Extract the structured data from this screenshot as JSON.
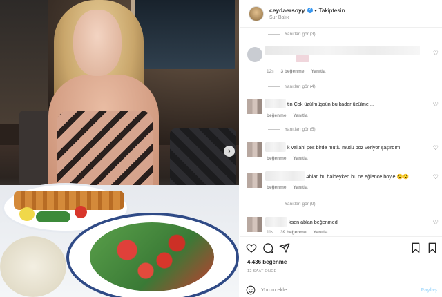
{
  "post": {
    "username": "ceydaersoyy",
    "follow_state": "Takiptesin",
    "location": "Sur Balık",
    "likes": "4.436 beğenme",
    "time": "12 SAAT ÖNCE"
  },
  "comments": [
    {
      "type": "view_replies",
      "text": "Yanıtları gör (3)"
    },
    {
      "type": "comment",
      "text": "",
      "meta_time": "12s",
      "meta_likes": "3 beğenme",
      "meta_reply": "Yanıtla"
    },
    {
      "type": "view_replies",
      "text": "Yanıtları gör (4)"
    },
    {
      "type": "comment",
      "text": "tin Çok üzülmüşsün bu kadar üzülme ...",
      "meta_likes": "beğenme",
      "meta_reply": "Yanıtla"
    },
    {
      "type": "view_replies",
      "text": "Yanıtları gör (5)"
    },
    {
      "type": "comment",
      "text": "k vallahi pes birde mutlu mutlu poz veriyor şaşırdım",
      "meta_likes": "beğenme",
      "meta_reply": "Yanıtla"
    },
    {
      "type": "comment",
      "text": "Ablan bu haldeyken bu ne eğlence böyle 😮😮",
      "meta_likes": "beğenme",
      "meta_reply": "Yanıtla"
    },
    {
      "type": "view_replies",
      "text": "Yanıtları gör (9)"
    },
    {
      "type": "comment",
      "text": "ksen ablan beğenmedi",
      "meta_time": "11s",
      "meta_likes": "39 beğenme",
      "meta_reply": "Yanıtla"
    }
  ],
  "add_comment": {
    "placeholder": "Yorum ekle...",
    "post_label": "Paylaş"
  },
  "icons": {
    "like": "heart-icon",
    "comment": "comment-icon",
    "share": "share-icon",
    "save": "bookmark-icon",
    "emoji": "emoji-icon",
    "next": "chevron-right-icon"
  }
}
